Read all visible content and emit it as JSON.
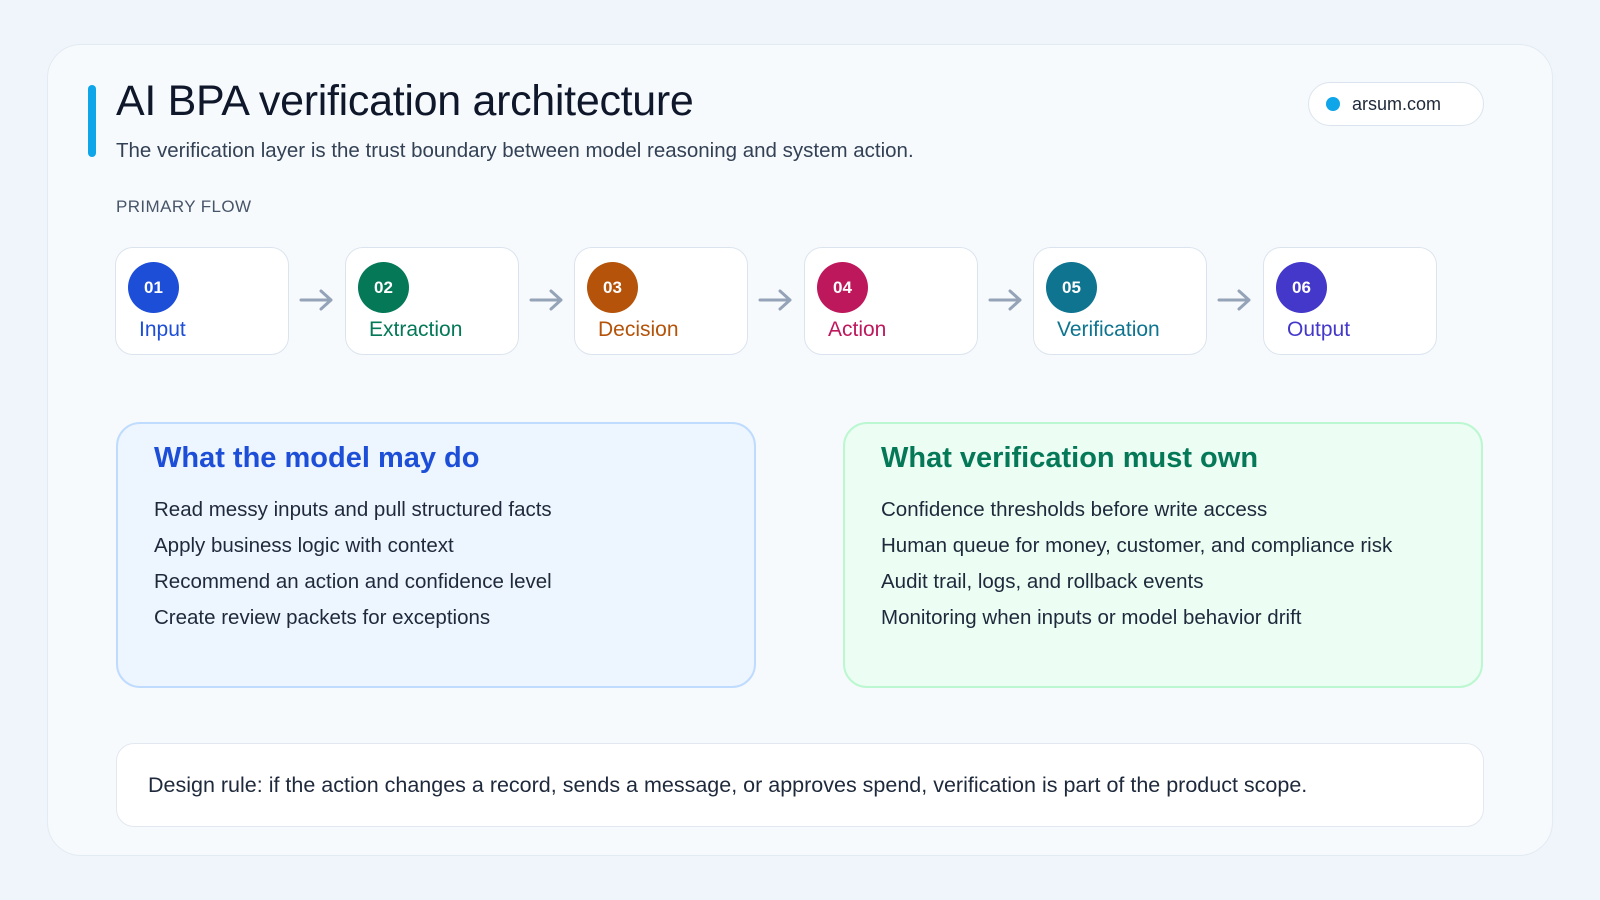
{
  "header": {
    "title": "AI BPA verification architecture",
    "subtitle": "The verification layer is the trust boundary between model reasoning and system action.",
    "site": "arsum.com",
    "accent_color": "#0ea5e9"
  },
  "flow": {
    "label": "PRIMARY FLOW",
    "steps": [
      {
        "number": "01",
        "label": "Input",
        "color": "#1d4ed8",
        "text_color": "#1d4ed8"
      },
      {
        "number": "02",
        "label": "Extraction",
        "color": "#047857",
        "text_color": "#047857"
      },
      {
        "number": "03",
        "label": "Decision",
        "color": "#b45309",
        "text_color": "#b45309"
      },
      {
        "number": "04",
        "label": "Action",
        "color": "#be185d",
        "text_color": "#be185d"
      },
      {
        "number": "05",
        "label": "Verification",
        "color": "#0e7490",
        "text_color": "#0e7490"
      },
      {
        "number": "06",
        "label": "Output",
        "color": "#4338ca",
        "text_color": "#4338ca"
      }
    ],
    "arrow_color": "#94a3b8"
  },
  "model_panel": {
    "title": "What the model may do",
    "title_color": "#1d4ed8",
    "items": [
      "Read messy inputs and pull structured facts",
      "Apply business logic with context",
      "Recommend an action and confidence level",
      "Create review packets for exceptions"
    ]
  },
  "verification_panel": {
    "title": "What verification must own",
    "title_color": "#047857",
    "items": [
      "Confidence thresholds before write access",
      "Human queue for money, customer, and compliance risk",
      "Audit trail, logs, and rollback events",
      "Monitoring when inputs or model behavior drift"
    ]
  },
  "design_rule": {
    "text": "Design rule: if the action changes a record, sends a message, or approves spend, verification is part of the product scope."
  }
}
